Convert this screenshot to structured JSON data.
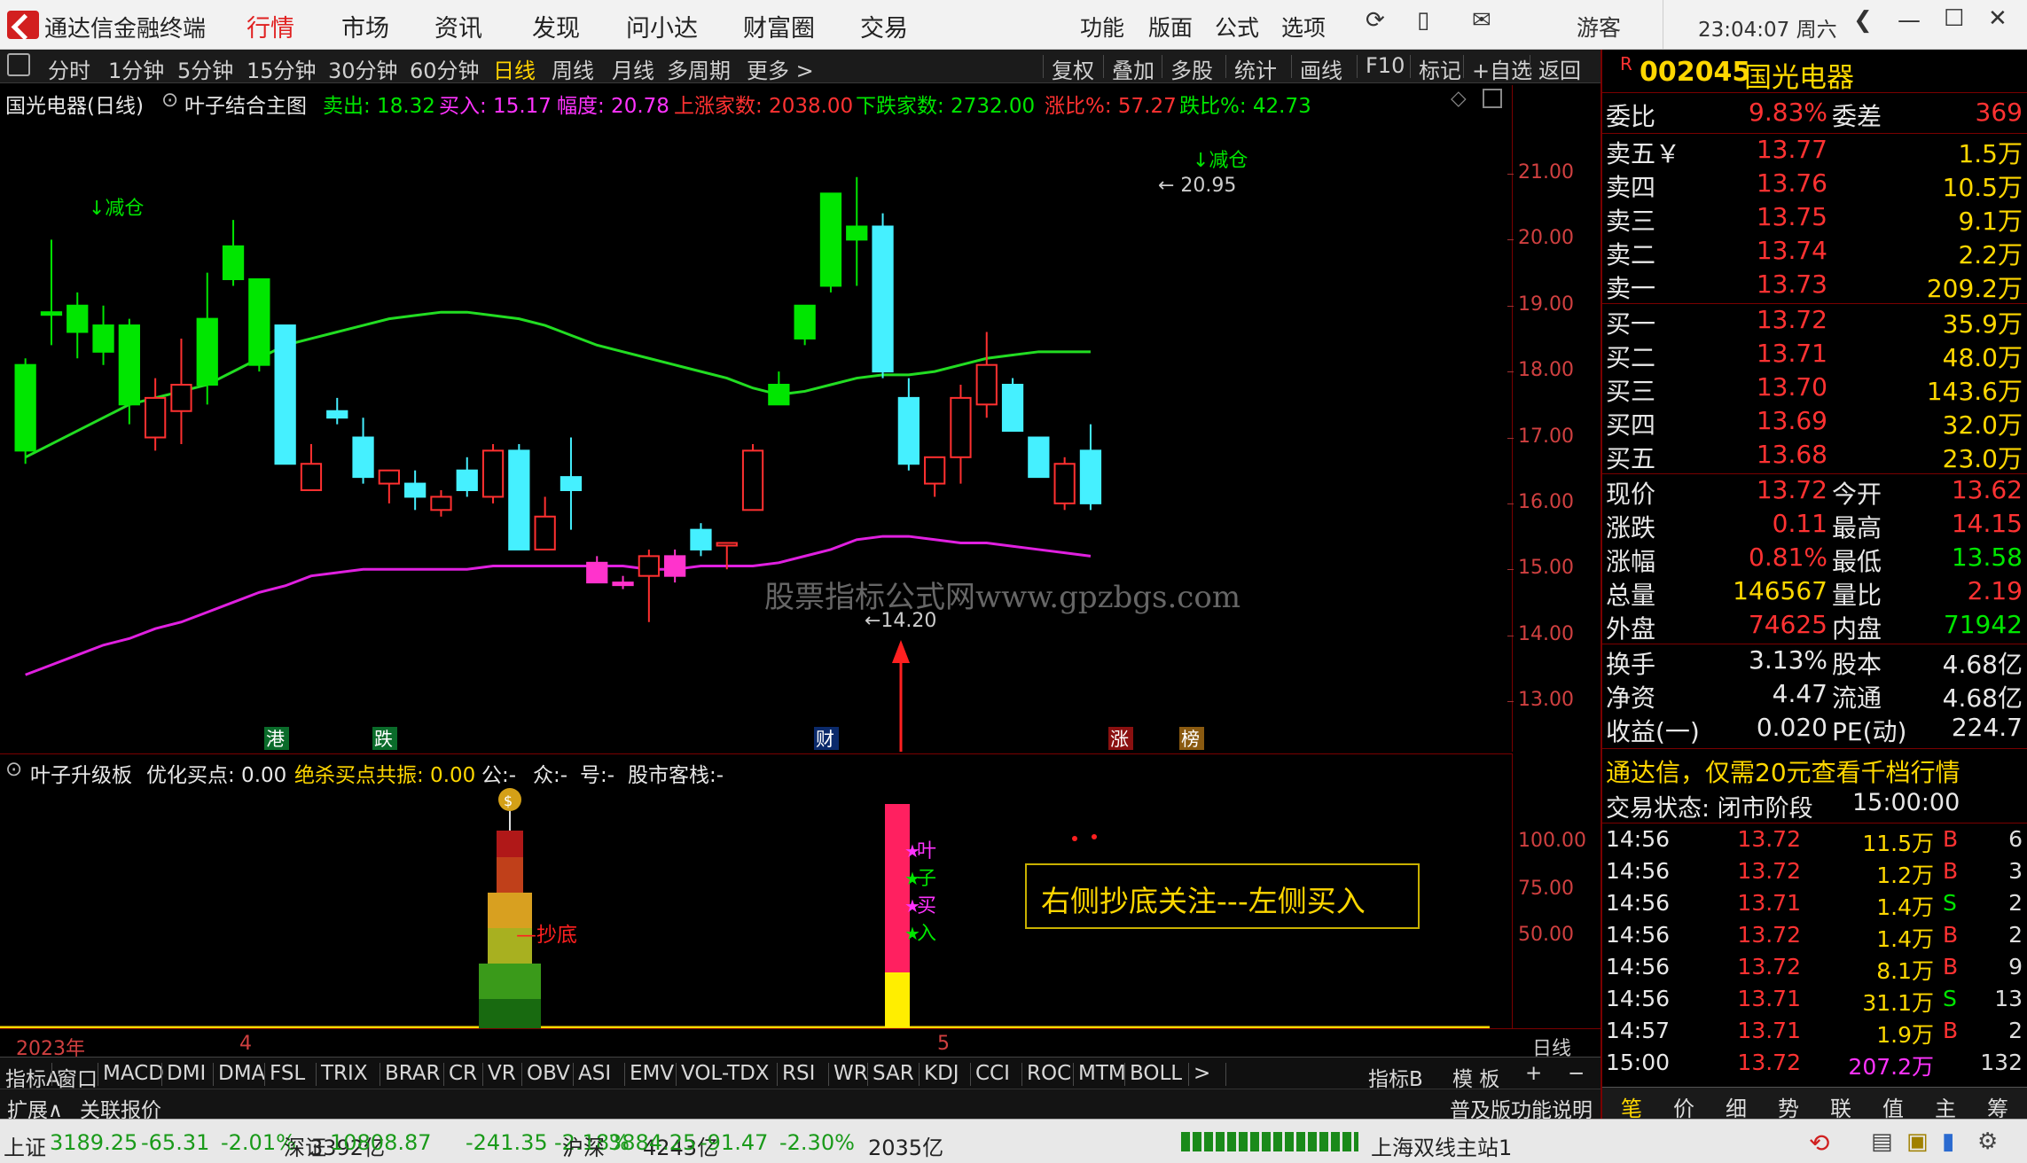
{
  "app": {
    "title": "通达信金融终端"
  },
  "menu": [
    "行情",
    "市场",
    "资讯",
    "发现",
    "问小达",
    "财富圈",
    "交易"
  ],
  "right_menu": [
    "功能",
    "版面",
    "公式",
    "选项"
  ],
  "user": "游客",
  "clock": "23:04:07 周六",
  "periods": [
    "分时",
    "1分钟",
    "5分钟",
    "15分钟",
    "30分钟",
    "60分钟",
    "日线",
    "周线",
    "月线",
    "多周期",
    "更多 >"
  ],
  "tools": [
    "复权",
    "叠加",
    "多股",
    "统计",
    "画线",
    "F10",
    "标记",
    "+自选",
    "返回"
  ],
  "chart": {
    "name": "国光电器(日线)",
    "template": "叶子结合主图",
    "stats": [
      {
        "label": "卖出:",
        "value": "18.32",
        "color": "#00e600"
      },
      {
        "label": "买入:",
        "value": "15.17",
        "color": "#ff33ff"
      },
      {
        "label": "幅度:",
        "value": "20.78",
        "color": "#ff33ff"
      },
      {
        "label": "上涨家数:",
        "value": "2038.00",
        "color": "#ff3232"
      },
      {
        "label": "下跌家数:",
        "value": "2732.00",
        "color": "#00e600"
      },
      {
        "label": "涨比%:",
        "value": "57.27",
        "color": "#ff3232"
      },
      {
        "label": "跌比%:",
        "value": "42.73",
        "color": "#00e600"
      }
    ],
    "annotations": {
      "sell1": "↓减仓",
      "sell2": "↓减仓",
      "high": "20.95",
      "low": "14.20"
    },
    "flags": [
      "港",
      "跌",
      "财",
      "涨",
      "榜"
    ],
    "watermark": "股票指标公式网www.gpzbgs.com"
  },
  "chart_data": {
    "type": "candlestick",
    "ylim": [
      12.4,
      21.8
    ],
    "yticks": [
      13.0,
      14.0,
      15.0,
      16.0,
      17.0,
      18.0,
      19.0,
      20.0,
      21.0
    ],
    "candles": [
      {
        "o": 16.8,
        "h": 18.2,
        "l": 16.6,
        "c": 18.1,
        "t": "up"
      },
      {
        "o": 18.9,
        "h": 20.0,
        "l": 18.4,
        "c": 18.9,
        "t": "up2"
      },
      {
        "o": 18.6,
        "h": 19.2,
        "l": 18.2,
        "c": 19.0,
        "t": "up"
      },
      {
        "o": 18.3,
        "h": 19.0,
        "l": 18.1,
        "c": 18.7,
        "t": "up"
      },
      {
        "o": 17.5,
        "h": 18.8,
        "l": 17.2,
        "c": 18.7,
        "t": "up"
      },
      {
        "o": 17.6,
        "h": 17.9,
        "l": 16.8,
        "c": 17.0,
        "t": "hollow"
      },
      {
        "o": 17.8,
        "h": 18.5,
        "l": 16.9,
        "c": 17.4,
        "t": "hollow"
      },
      {
        "o": 17.8,
        "h": 19.5,
        "l": 17.5,
        "c": 18.8,
        "t": "up"
      },
      {
        "o": 19.9,
        "h": 20.3,
        "l": 19.3,
        "c": 19.4,
        "t": "up"
      },
      {
        "o": 18.1,
        "h": 19.4,
        "l": 18.0,
        "c": 19.4,
        "t": "up"
      },
      {
        "o": 18.7,
        "h": 18.7,
        "l": 16.6,
        "c": 16.6,
        "t": "down"
      },
      {
        "o": 16.2,
        "h": 16.9,
        "l": 16.2,
        "c": 16.6,
        "t": "hollow"
      },
      {
        "o": 17.4,
        "h": 17.6,
        "l": 17.2,
        "c": 17.3,
        "t": "down"
      },
      {
        "o": 17.0,
        "h": 17.3,
        "l": 16.3,
        "c": 16.4,
        "t": "down"
      },
      {
        "o": 16.3,
        "h": 16.5,
        "l": 16.0,
        "c": 16.5,
        "t": "hollow"
      },
      {
        "o": 16.3,
        "h": 16.5,
        "l": 15.9,
        "c": 16.1,
        "t": "down"
      },
      {
        "o": 15.9,
        "h": 16.2,
        "l": 15.8,
        "c": 16.1,
        "t": "hollow"
      },
      {
        "o": 16.5,
        "h": 16.7,
        "l": 16.1,
        "c": 16.2,
        "t": "down"
      },
      {
        "o": 16.1,
        "h": 16.9,
        "l": 16.0,
        "c": 16.8,
        "t": "hollow"
      },
      {
        "o": 16.8,
        "h": 16.9,
        "l": 15.3,
        "c": 15.3,
        "t": "down"
      },
      {
        "o": 15.3,
        "h": 16.1,
        "l": 15.3,
        "c": 15.8,
        "t": "hollow"
      },
      {
        "o": 16.4,
        "h": 17.0,
        "l": 15.6,
        "c": 16.2,
        "t": "down"
      },
      {
        "o": 15.1,
        "h": 15.2,
        "l": 14.8,
        "c": 14.8,
        "t": "magenta"
      },
      {
        "o": 14.8,
        "h": 14.9,
        "l": 14.7,
        "c": 14.8,
        "t": "magenta"
      },
      {
        "o": 14.9,
        "h": 15.3,
        "l": 14.2,
        "c": 15.2,
        "t": "hollow"
      },
      {
        "o": 15.2,
        "h": 15.3,
        "l": 14.8,
        "c": 14.9,
        "t": "magenta"
      },
      {
        "o": 15.6,
        "h": 15.7,
        "l": 15.2,
        "c": 15.3,
        "t": "down"
      },
      {
        "o": 15.4,
        "h": 15.4,
        "l": 15.0,
        "c": 15.4,
        "t": "hollow"
      },
      {
        "o": 15.9,
        "h": 16.9,
        "l": 16.0,
        "c": 16.8,
        "t": "hollow"
      },
      {
        "o": 17.5,
        "h": 18.0,
        "l": 17.5,
        "c": 17.8,
        "t": "up"
      },
      {
        "o": 18.5,
        "h": 19.0,
        "l": 18.4,
        "c": 19.0,
        "t": "up"
      },
      {
        "o": 19.3,
        "h": 20.7,
        "l": 19.2,
        "c": 20.7,
        "t": "up"
      },
      {
        "o": 20.0,
        "h": 20.95,
        "l": 19.3,
        "c": 20.2,
        "t": "up"
      },
      {
        "o": 18.0,
        "h": 20.4,
        "l": 17.9,
        "c": 20.2,
        "t": "down"
      },
      {
        "o": 17.6,
        "h": 17.9,
        "l": 16.5,
        "c": 16.6,
        "t": "down"
      },
      {
        "o": 16.3,
        "h": 16.7,
        "l": 16.1,
        "c": 16.7,
        "t": "hollow"
      },
      {
        "o": 16.7,
        "h": 17.8,
        "l": 16.3,
        "c": 17.6,
        "t": "hollow"
      },
      {
        "o": 17.5,
        "h": 18.6,
        "l": 17.3,
        "c": 18.1,
        "t": "hollow"
      },
      {
        "o": 17.8,
        "h": 17.9,
        "l": 17.1,
        "c": 17.1,
        "t": "down"
      },
      {
        "o": 17.0,
        "h": 17.0,
        "l": 16.4,
        "c": 16.4,
        "t": "down"
      },
      {
        "o": 16.0,
        "h": 16.7,
        "l": 15.9,
        "c": 16.6,
        "t": "hollow"
      },
      {
        "o": 16.8,
        "h": 17.2,
        "l": 15.9,
        "c": 16.0,
        "t": "down"
      }
    ],
    "sell_line": [
      16.7,
      16.9,
      17.1,
      17.3,
      17.5,
      17.6,
      17.7,
      17.8,
      18.0,
      18.2,
      18.4,
      18.5,
      18.6,
      18.7,
      18.8,
      18.85,
      18.9,
      18.9,
      18.85,
      18.8,
      18.7,
      18.55,
      18.4,
      18.3,
      18.2,
      18.1,
      18.0,
      17.9,
      17.75,
      17.65,
      17.7,
      17.8,
      17.9,
      17.95,
      17.95,
      18.0,
      18.1,
      18.2,
      18.25,
      18.3,
      18.3,
      18.3
    ],
    "buy_line": [
      13.4,
      13.55,
      13.7,
      13.85,
      13.95,
      14.1,
      14.2,
      14.35,
      14.5,
      14.65,
      14.75,
      14.9,
      14.95,
      15.0,
      15.0,
      15.0,
      15.0,
      15.0,
      15.05,
      15.05,
      15.05,
      15.05,
      15.05,
      15.05,
      15.0,
      15.0,
      15.05,
      15.05,
      15.05,
      15.1,
      15.2,
      15.3,
      15.45,
      15.5,
      15.5,
      15.45,
      15.4,
      15.4,
      15.35,
      15.3,
      15.25,
      15.2
    ]
  },
  "sub": {
    "name": "叶子升级板",
    "items": [
      {
        "label": "优化买点:",
        "value": "0.00",
        "color": "#e8e8e8"
      },
      {
        "label": "绝杀买点共振:",
        "value": "0.00",
        "color": "#ffd700"
      },
      {
        "label": "公:-",
        "value": "",
        "color": "#e8e8e8"
      },
      {
        "label": "众:-",
        "value": "",
        "color": "#e8e8e8"
      },
      {
        "label": "号:-",
        "value": "",
        "color": "#e8e8e8"
      },
      {
        "label": "股市客栈:-",
        "value": "",
        "color": "#e8e8e8"
      }
    ],
    "yticks": [
      "100.00",
      "75.00",
      "50.00"
    ],
    "note": "右侧抄底关注---左侧买入",
    "tag": "抄底",
    "leaf": [
      "叶",
      "子",
      "买",
      "入"
    ]
  },
  "dates": {
    "year": "2023年",
    "m4": "4",
    "m5": "5",
    "period": "日线"
  },
  "indicators": [
    "指标A",
    "窗口",
    "MACD",
    "DMI",
    "DMA",
    "FSL",
    "TRIX",
    "BRAR",
    "CR",
    "VR",
    "OBV",
    "ASI",
    "EMV",
    "VOL-TDX",
    "RSI",
    "WR",
    "SAR",
    "KDJ",
    "CCI",
    "ROC",
    "MTM",
    "BOLL",
    ">"
  ],
  "ind_right": [
    "指标B",
    "模 板",
    "+",
    "−"
  ],
  "ext": {
    "left": "扩展∧",
    "link": "关联报价",
    "right": "普及版功能说明"
  },
  "side_tabs": [
    "笔",
    "价",
    "细",
    "势",
    "联",
    "值",
    "主",
    "筹"
  ],
  "quote": {
    "code": "002045",
    "name": "国光电器",
    "wb": {
      "label": "委比",
      "value": "9.83%",
      "label2": "委差",
      "value2": "369"
    },
    "asks": [
      {
        "l": "卖五",
        "p": "13.77",
        "v": "1.5万"
      },
      {
        "l": "卖四",
        "p": "13.76",
        "v": "10.5万"
      },
      {
        "l": "卖三",
        "p": "13.75",
        "v": "9.1万"
      },
      {
        "l": "卖二",
        "p": "13.74",
        "v": "2.2万"
      },
      {
        "l": "卖一",
        "p": "13.73",
        "v": "209.2万"
      }
    ],
    "bids": [
      {
        "l": "买一",
        "p": "13.72",
        "v": "35.9万"
      },
      {
        "l": "买二",
        "p": "13.71",
        "v": "48.0万"
      },
      {
        "l": "买三",
        "p": "13.70",
        "v": "143.6万"
      },
      {
        "l": "买四",
        "p": "13.69",
        "v": "32.0万"
      },
      {
        "l": "买五",
        "p": "13.68",
        "v": "23.0万"
      }
    ],
    "stats": [
      {
        "l": "现价",
        "v": "13.72",
        "vc": "red",
        "l2": "今开",
        "v2": "13.62",
        "v2c": "red"
      },
      {
        "l": "涨跌",
        "v": "0.11",
        "vc": "red",
        "l2": "最高",
        "v2": "14.15",
        "v2c": "red"
      },
      {
        "l": "涨幅",
        "v": "0.81%",
        "vc": "red",
        "l2": "最低",
        "v2": "13.58",
        "v2c": "green"
      },
      {
        "l": "总量",
        "v": "146567",
        "vc": "yellow",
        "l2": "量比",
        "v2": "2.19",
        "v2c": "red"
      },
      {
        "l": "外盘",
        "v": "74625",
        "vc": "red",
        "l2": "内盘",
        "v2": "71942",
        "v2c": "green"
      }
    ],
    "stats2": [
      {
        "l": "换手",
        "v": "3.13%",
        "l2": "股本",
        "v2": "4.68亿"
      },
      {
        "l": "净资",
        "v": "4.47",
        "l2": "流通",
        "v2": "4.68亿"
      },
      {
        "l": "收益(一)",
        "v": "0.020",
        "l2": "PE(动)",
        "v2": "224.7"
      }
    ],
    "promo": "通达信，仅需20元查看千档行情",
    "trade_state": "交易状态: 闭市阶段",
    "trade_time": "15:00:00",
    "ticks": [
      {
        "t": "14:56",
        "p": "13.72",
        "v": "11.5万",
        "s": "B",
        "n": "6"
      },
      {
        "t": "14:56",
        "p": "13.72",
        "v": "1.2万",
        "s": "B",
        "n": "3"
      },
      {
        "t": "14:56",
        "p": "13.71",
        "v": "1.4万",
        "s": "S",
        "n": "2"
      },
      {
        "t": "14:56",
        "p": "13.72",
        "v": "1.4万",
        "s": "B",
        "n": "2"
      },
      {
        "t": "14:56",
        "p": "13.72",
        "v": "8.1万",
        "s": "B",
        "n": "9"
      },
      {
        "t": "14:56",
        "p": "13.71",
        "v": "31.1万",
        "s": "S",
        "n": "13"
      },
      {
        "t": "14:57",
        "p": "13.71",
        "v": "1.9万",
        "s": "B",
        "n": "2"
      },
      {
        "t": "15:00",
        "p": "13.72",
        "v": "207.2万",
        "s": "",
        "n": "132"
      }
    ]
  },
  "status": {
    "items": [
      {
        "name": "上证",
        "val": "3189.25",
        "chg": "-65.31",
        "pct": "-2.01%",
        "amt": "3392亿"
      },
      {
        "name": "深证",
        "val": "10808.87",
        "chg": "-241.35",
        "pct": "-2.18%",
        "amt": "4243亿"
      },
      {
        "name": "沪深",
        "val": "3884.25",
        "chg": "-91.47",
        "pct": "-2.30%",
        "amt": "2035亿"
      }
    ],
    "server": "上海双线主站1"
  }
}
